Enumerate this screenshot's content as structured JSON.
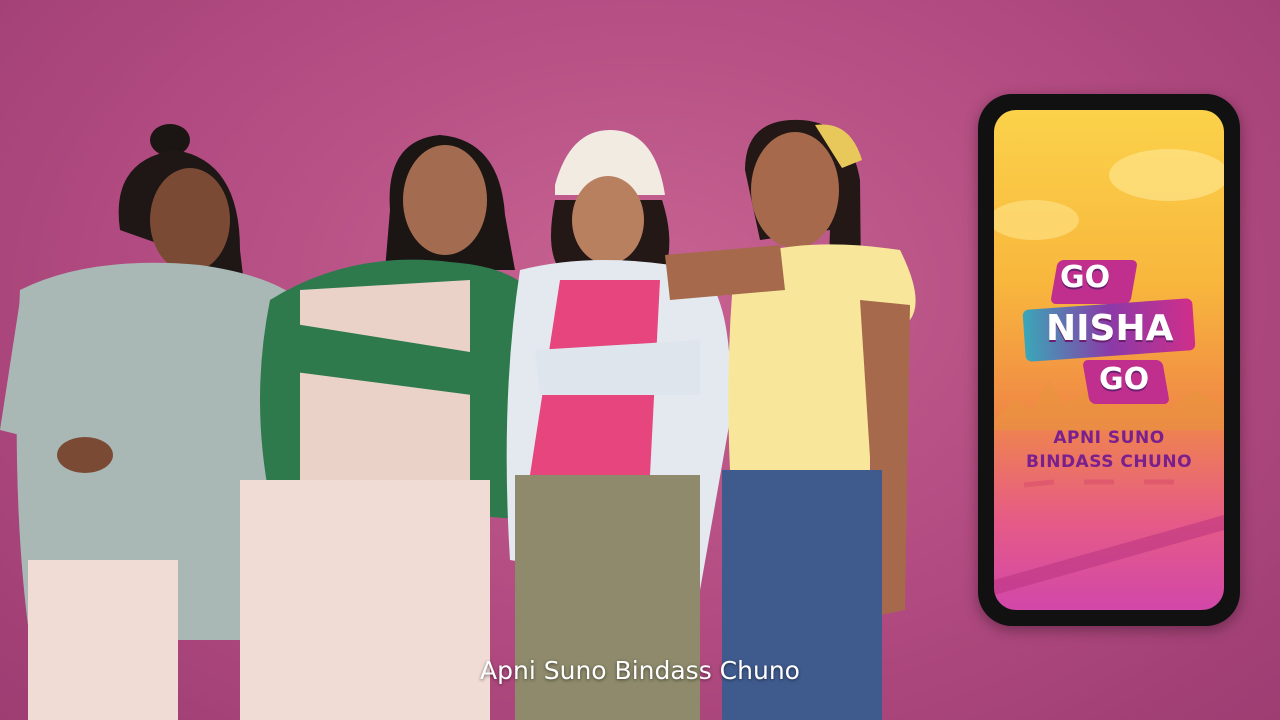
{
  "scene": {
    "background_color": "#b24b81",
    "subject": "four young women posing together in front of a pink wall"
  },
  "phone": {
    "logo_word_top": "GO",
    "logo_word_middle": "NISHA",
    "logo_word_bottom": "GO",
    "tagline_line1": "APNI SUNO",
    "tagline_line2": "BINDASS CHUNO",
    "accent_colors": [
      "#fbd24a",
      "#f08a45",
      "#d247a9",
      "#7a1f8e"
    ]
  },
  "subtitle": "Apni Suno Bindass Chuno"
}
